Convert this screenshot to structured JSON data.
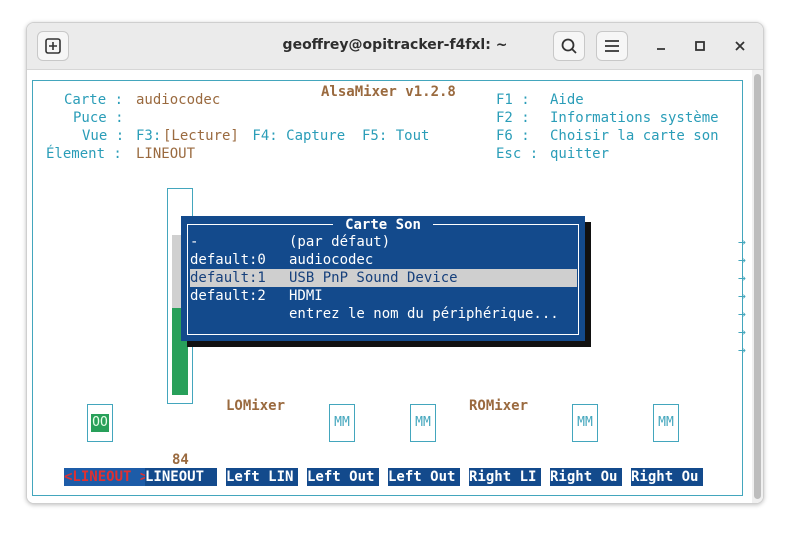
{
  "window": {
    "title": "geoffrey@opitracker-f4fxl: ~"
  },
  "icons": {
    "new_tab": "new-tab-icon",
    "search": "search-icon",
    "menu": "hamburger-menu-icon",
    "minimize": "minimize-icon",
    "maximize": "maximize-icon",
    "close": "close-icon"
  },
  "alsamixer": {
    "title": "AlsaMixer v1.2.8",
    "info": [
      {
        "label": "Carte :",
        "value": "audiocodec"
      },
      {
        "label": "Puce :",
        "value": ""
      },
      {
        "label": "Vue :",
        "value": "F3:",
        "selected": "[Lecture]",
        "rest": " F4: Capture  F5: Tout"
      },
      {
        "label": "Élement :",
        "value": "LINEOUT"
      }
    ],
    "keys": [
      {
        "key": "F1 :",
        "desc": "Aide"
      },
      {
        "key": "F2 :",
        "desc": "Informations système"
      },
      {
        "key": "F6 :",
        "desc": "Choisir la carte son"
      },
      {
        "key": "Esc :",
        "desc": "quitter"
      }
    ],
    "mixers": {
      "left": "LOMixer",
      "right": "ROMixer"
    },
    "switch_states": [
      "OO",
      "MM",
      "MM",
      "MM",
      "MM"
    ],
    "volume_value": "84",
    "volume_level": 0.84,
    "tabs": [
      "<LINEOUT >",
      "LINEOUT ",
      "Left LIN",
      "Left Out",
      "Left Out",
      "Right LI",
      "Right Ou",
      "Right Ou"
    ],
    "scroll_arrow": "→"
  },
  "dialog": {
    "title": "Carte Son",
    "items": [
      {
        "id": "-",
        "name": "(par défaut)"
      },
      {
        "id": "default:0",
        "name": "audiocodec"
      },
      {
        "id": "default:1",
        "name": "USB PnP Sound Device",
        "selected": true
      },
      {
        "id": "default:2",
        "name": "HDMI"
      },
      {
        "id": "",
        "name": "entrez le nom du périphérique..."
      }
    ]
  },
  "colors": {
    "accent": "#2a9db8",
    "label": "#9a6a3f",
    "dialog_bg": "#134a8c",
    "selection": "#cfcfcf",
    "green": "#28a05a"
  }
}
